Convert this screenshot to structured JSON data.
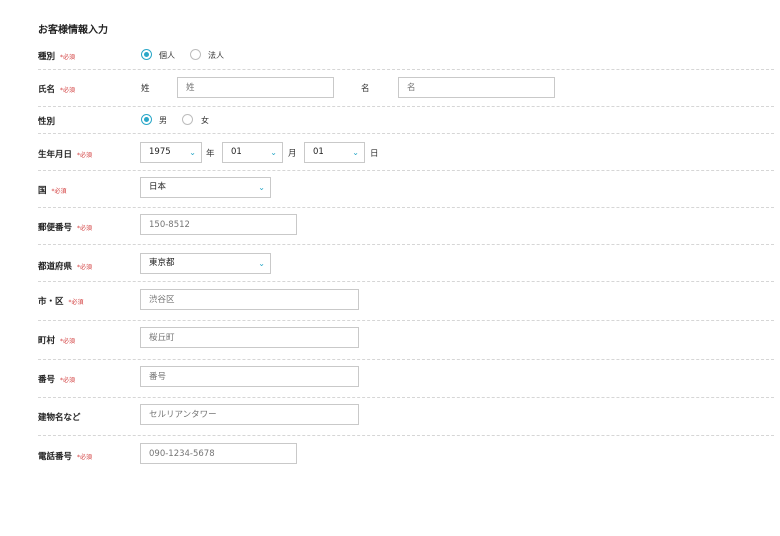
{
  "form": {
    "title": "お客様情報入力",
    "required_mark": "*必須",
    "type": {
      "label": "種別",
      "options": [
        "個人",
        "法人"
      ],
      "selected": "個人"
    },
    "name": {
      "label": "氏名",
      "last_label": "姓",
      "last_placeholder": "姓",
      "first_label": "名",
      "first_placeholder": "名"
    },
    "gender": {
      "label": "性別",
      "options": [
        "男",
        "女"
      ],
      "selected": "男"
    },
    "birth": {
      "label": "生年月日",
      "year": "1975",
      "year_unit": "年",
      "month": "01",
      "month_unit": "月",
      "day": "01",
      "day_unit": "日"
    },
    "country": {
      "label": "国",
      "value": "日本"
    },
    "postal": {
      "label": "郵便番号",
      "placeholder": "150-8512"
    },
    "prefecture": {
      "label": "都道府県",
      "value": "東京都"
    },
    "city": {
      "label": "市・区",
      "placeholder": "渋谷区"
    },
    "town": {
      "label": "町村",
      "placeholder": "桜丘町"
    },
    "block": {
      "label": "番号",
      "placeholder": "番号"
    },
    "building": {
      "label": "建物名など",
      "placeholder": "セルリアンタワー"
    },
    "phone": {
      "label": "電話番号",
      "placeholder": "090-1234-5678"
    }
  },
  "colors": {
    "accent": "#2aa7c8",
    "required": "#d23c3c",
    "border": "#c9c9c9",
    "divider": "#d6d6d6"
  },
  "icons": {
    "dropdown": "chevron-down-icon"
  }
}
